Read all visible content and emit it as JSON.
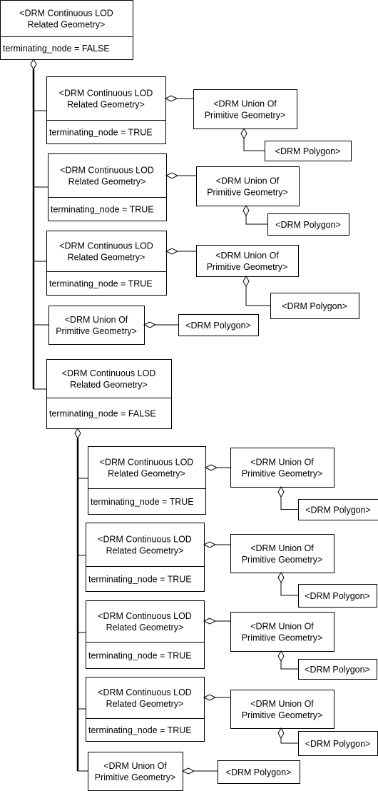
{
  "labels": {
    "lod_line1": "<DRM Continuous LOD",
    "lod_line2": "Related Geometry>",
    "union_line1": "<DRM Union Of",
    "union_line2": "Primitive Geometry>",
    "polygon": "<DRM Polygon>",
    "attr_false": "terminating_node = FALSE",
    "attr_true": "terminating_node = TRUE"
  },
  "tree": {
    "root": {
      "type": "lod",
      "attr": "attr_false"
    },
    "level1": [
      {
        "type": "lod",
        "attr": "attr_true",
        "union": true
      },
      {
        "type": "lod",
        "attr": "attr_true",
        "union": true
      },
      {
        "type": "lod",
        "attr": "attr_true",
        "union": true
      },
      {
        "type": "union"
      },
      {
        "type": "lod",
        "attr": "attr_false"
      }
    ],
    "level2": [
      {
        "type": "lod",
        "attr": "attr_true",
        "union": true
      },
      {
        "type": "lod",
        "attr": "attr_true",
        "union": true
      },
      {
        "type": "lod",
        "attr": "attr_true",
        "union": true
      },
      {
        "type": "lod",
        "attr": "attr_true",
        "union": true
      },
      {
        "type": "union"
      }
    ]
  }
}
